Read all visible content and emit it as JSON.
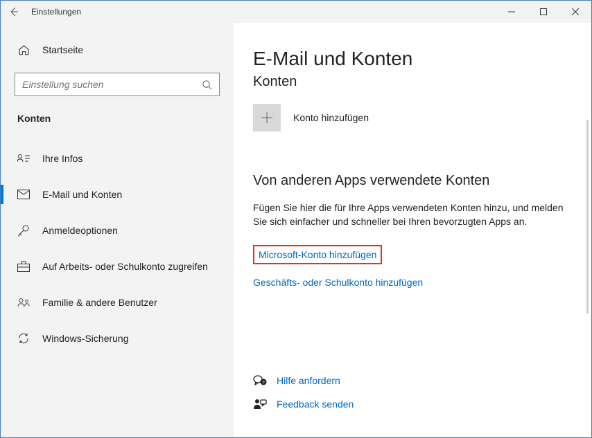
{
  "window": {
    "title": "Einstellungen"
  },
  "sidebar": {
    "home_label": "Startseite",
    "search_placeholder": "Einstellung suchen",
    "section_label": "Konten",
    "items": [
      {
        "label": "Ihre Infos"
      },
      {
        "label": "E-Mail und Konten"
      },
      {
        "label": "Anmeldeoptionen"
      },
      {
        "label": "Auf Arbeits- oder Schulkonto zugreifen"
      },
      {
        "label": "Familie & andere Benutzer"
      },
      {
        "label": "Windows-Sicherung"
      }
    ]
  },
  "main": {
    "page_title": "E-Mail und Konten",
    "sub_heading": "Konten",
    "add_account_label": "Konto hinzufügen",
    "other_apps_title": "Von anderen Apps verwendete Konten",
    "other_apps_desc": "Fügen Sie hier die für Ihre Apps verwendeten Konten hinzu, und melden Sie sich einfacher und schneller bei Ihren bevorzugten Apps an.",
    "link_ms_account": "Microsoft-Konto hinzufügen",
    "link_work_school": "Geschäfts- oder Schulkonto hinzufügen",
    "help_label": "Hilfe anfordern",
    "feedback_label": "Feedback senden"
  }
}
